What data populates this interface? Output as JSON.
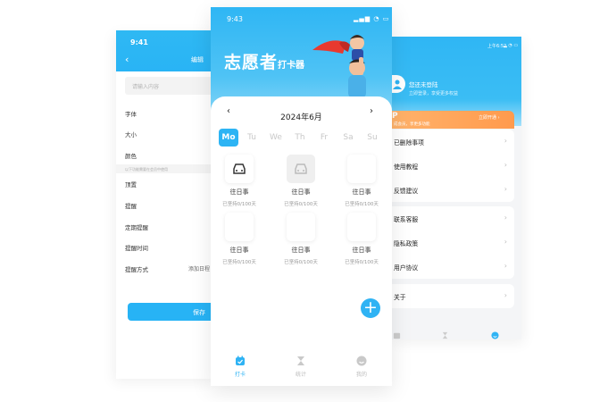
{
  "left_screen": {
    "status_time": "9:41",
    "title": "编辑",
    "input_placeholder": "请输入内容",
    "settings": [
      "字体",
      "大小",
      "颜色"
    ],
    "note": "以下功能需要在会员中使用",
    "reminder_settings": [
      "顶置",
      "提醒",
      "定期提醒",
      "提醒时间",
      "提醒方式"
    ],
    "add_reminder": "添加日程",
    "save_label": "保存"
  },
  "center_screen": {
    "status_time": "9:43",
    "title_main": "志愿者",
    "title_sub": "打卡器",
    "month": "2024年6月",
    "weekdays": [
      "Mo",
      "Tu",
      "We",
      "Th",
      "Fr",
      "Sa",
      "Su"
    ],
    "active_weekday": "Mo",
    "cards": [
      {
        "name": "往日事",
        "days": "已坚持0/100天"
      },
      {
        "name": "往日事",
        "days": "已坚持0/100天"
      },
      {
        "name": "往日事",
        "days": "已坚持0/100天"
      },
      {
        "name": "往日事",
        "days": "已坚持0/100天"
      },
      {
        "name": "往日事",
        "days": "已坚持0/100天"
      },
      {
        "name": "往日事",
        "days": "已坚持0/100天"
      }
    ],
    "tabs": [
      {
        "label": "打卡",
        "icon": "calendar-check-icon"
      },
      {
        "label": "统计",
        "icon": "hourglass-icon"
      },
      {
        "label": "我的",
        "icon": "profile-icon"
      }
    ]
  },
  "right_screen": {
    "status_time": "上午6:52",
    "login_title": "您还未登陆",
    "login_sub": "立即登录，享受更多权益",
    "vip_letter": "P",
    "vip_sub": "成会员，享更多功能",
    "vip_button": "立即开通 ›",
    "group1": [
      "已删除事项",
      "使用教程",
      "反馈建议"
    ],
    "group2": [
      "联系客服",
      "隐私政策",
      "用户协议"
    ],
    "group3": [
      "关于"
    ],
    "tabs": [
      {
        "label": "打卡",
        "icon": "calendar-check-icon"
      },
      {
        "label": "统计",
        "icon": "hourglass-icon"
      },
      {
        "label": "我的",
        "icon": "profile-icon"
      }
    ]
  },
  "colors": {
    "brand_blue": "#2fb3f4",
    "vip_orange": "#ff9a4d"
  }
}
